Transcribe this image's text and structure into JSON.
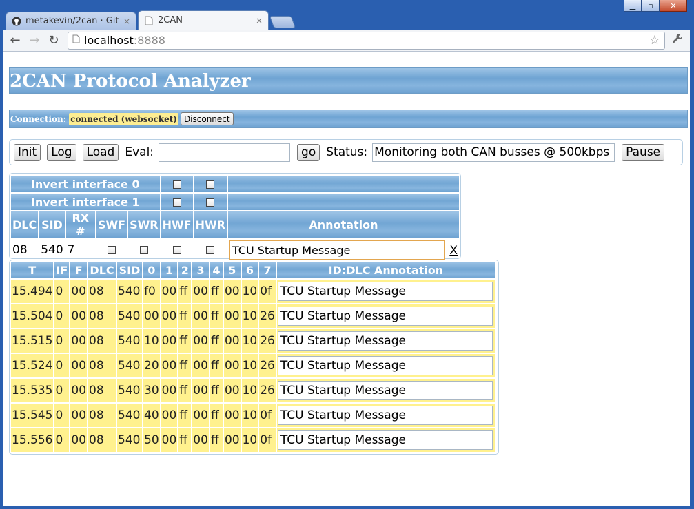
{
  "window": {
    "controls": [
      "▁",
      "▫",
      "✕"
    ]
  },
  "tabs": [
    {
      "title": "metakevin/2can · Git",
      "icon": "github-icon",
      "close": "×",
      "active": false
    },
    {
      "title": "2CAN",
      "icon": "page-icon",
      "close": "×",
      "active": true
    }
  ],
  "toolbar": {
    "back": "←",
    "forward": "→",
    "reload": "↻",
    "url_host": "localhost",
    "url_port": ":8888",
    "star": "☆",
    "wrench": "🔧"
  },
  "page": {
    "title": "2CAN Protocol Analyzer",
    "connection_label": "Connection:",
    "connection_status": "connected (websocket)",
    "disconnect_label": "Disconnect",
    "init_label": "Init",
    "log_label": "Log",
    "load_label": "Load",
    "eval_label": "Eval:",
    "eval_value": "",
    "go_label": "go",
    "status_label": "Status:",
    "status_value": "Monitoring both CAN busses @ 500kbps",
    "pause_label": "Pause"
  },
  "filter": {
    "invert0": "Invert interface 0",
    "invert1": "Invert interface 1",
    "headers": [
      "DLC",
      "SID",
      "RX #",
      "SWF",
      "SWR",
      "HWF",
      "HWR",
      "Annotation"
    ],
    "row": {
      "dlc": "08",
      "sid": "540",
      "rx": "7",
      "annotation": "TCU Startup Message",
      "remove": "X"
    }
  },
  "data": {
    "headers": [
      "T",
      "IF",
      "F",
      "DLC",
      "SID",
      "0",
      "1",
      "2",
      "3",
      "4",
      "5",
      "6",
      "7",
      "ID:DLC Annotation"
    ],
    "rows": [
      [
        "15.494",
        "0",
        "00",
        "08",
        "540",
        "f0",
        "00",
        "ff",
        "00",
        "ff",
        "00",
        "10",
        "0f",
        "TCU Startup Message"
      ],
      [
        "15.504",
        "0",
        "00",
        "08",
        "540",
        "00",
        "00",
        "ff",
        "00",
        "ff",
        "00",
        "10",
        "26",
        "TCU Startup Message"
      ],
      [
        "15.515",
        "0",
        "00",
        "08",
        "540",
        "10",
        "00",
        "ff",
        "00",
        "ff",
        "00",
        "10",
        "26",
        "TCU Startup Message"
      ],
      [
        "15.524",
        "0",
        "00",
        "08",
        "540",
        "20",
        "00",
        "ff",
        "00",
        "ff",
        "00",
        "10",
        "26",
        "TCU Startup Message"
      ],
      [
        "15.535",
        "0",
        "00",
        "08",
        "540",
        "30",
        "00",
        "ff",
        "00",
        "ff",
        "00",
        "10",
        "26",
        "TCU Startup Message"
      ],
      [
        "15.545",
        "0",
        "00",
        "08",
        "540",
        "40",
        "00",
        "ff",
        "00",
        "ff",
        "00",
        "10",
        "0f",
        "TCU Startup Message"
      ],
      [
        "15.556",
        "0",
        "00",
        "08",
        "540",
        "50",
        "00",
        "ff",
        "00",
        "ff",
        "00",
        "10",
        "0f",
        "TCU Startup Message"
      ]
    ]
  },
  "colors": {
    "header_blue": "#7eb0dc",
    "row_yellow": "#fff18e",
    "status_yellow": "#fdee92"
  }
}
